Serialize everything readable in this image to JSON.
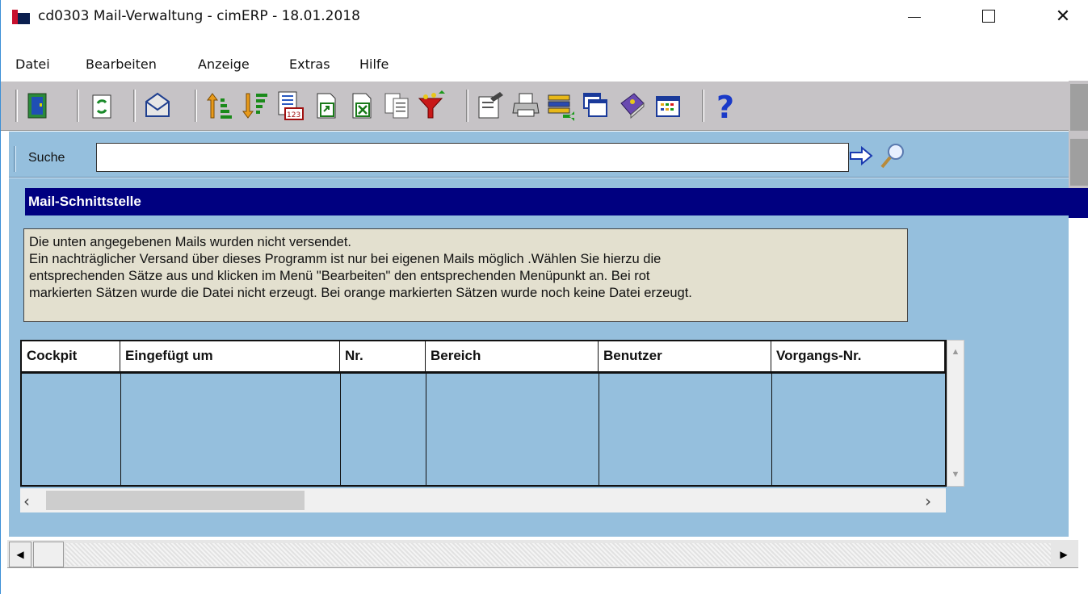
{
  "window": {
    "title": "cd0303 Mail-Verwaltung - cimERP - 18.01.2018",
    "minimize": "minimize",
    "maximize": "maximize",
    "close": "✕"
  },
  "menu": {
    "items": [
      "Datei",
      "Bearbeiten",
      "Anzeige",
      "Extras",
      "Hilfe"
    ]
  },
  "toolbar": {
    "buttons": [
      "exit-door-icon",
      "refresh-icon",
      "mail-envelope-icon",
      "sort-ascending-icon",
      "sort-descending-icon",
      "numbered-list-icon",
      "export-icon",
      "excel-icon",
      "copy-icon",
      "filter-funnel-icon",
      "properties-icon",
      "printer-icon",
      "batch-list-icon",
      "windows-icon",
      "notes-book-icon",
      "calendar-grid-icon",
      "help-icon"
    ]
  },
  "search": {
    "label": "Suche",
    "value": "",
    "placeholder": ""
  },
  "section": {
    "title": "Mail-Schnittstelle"
  },
  "info": {
    "lines": [
      "Die unten angegebenen Mails wurden nicht versendet.",
      "Ein nachträglicher Versand über dieses Programm ist nur bei eigenen Mails möglich .Wählen Sie hierzu die",
      "entsprechenden Sätze aus und klicken im Menü \"Bearbeiten\" den entsprechenden Menüpunkt an. Bei rot",
      "markierten Sätzen wurde die Datei nicht erzeugt. Bei orange markierten Sätzen wurde noch keine Datei erzeugt."
    ]
  },
  "table": {
    "columns": [
      "Cockpit",
      "Eingefügt um",
      "Nr.",
      "Bereich",
      "Benutzer",
      "Vorgangs-Nr."
    ],
    "rows": []
  },
  "colors": {
    "content_bg": "#95bfdd",
    "section_bg": "#000080",
    "info_bg": "#e3e0cf",
    "toolbar_bg": "#c6c3c6"
  }
}
